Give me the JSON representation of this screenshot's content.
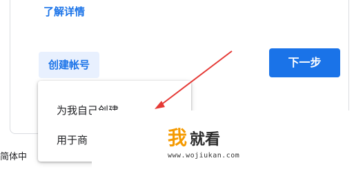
{
  "header": {
    "learn_more_link": "了解详情"
  },
  "actions": {
    "create_account_label": "创建帐号",
    "next_label": "下一步"
  },
  "create_menu": {
    "items": [
      {
        "label": "为我自己创建"
      },
      {
        "label": "用于商"
      }
    ]
  },
  "footer": {
    "language_label": "简体中"
  },
  "watermark": {
    "logo_text_a": "我",
    "logo_text_b": "就看",
    "url": "www.wojiukan.com"
  },
  "colors": {
    "accent": "#1a73e8",
    "accent_light": "#e8f0fe",
    "annotation_arrow": "#e53935",
    "watermark_orange": "#f59a00"
  }
}
